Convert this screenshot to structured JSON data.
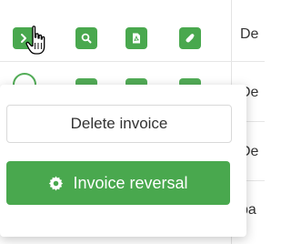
{
  "table": {
    "rows": [
      {
        "text": "De"
      },
      {
        "text": "De"
      },
      {
        "text": "De"
      },
      {
        "text": "pa"
      }
    ]
  },
  "toolbar": {
    "buttons": [
      {
        "name": "expand-button",
        "icon": "chevron-right-icon"
      },
      {
        "name": "view-button",
        "icon": "search-icon"
      },
      {
        "name": "pdf-button",
        "icon": "pdf-icon"
      },
      {
        "name": "attach-button",
        "icon": "paperclip-icon"
      }
    ]
  },
  "popup": {
    "delete_label": "Delete invoice",
    "reversal_label": "Invoice reversal",
    "reversal_icon": "gear-icon"
  },
  "colors": {
    "accent": "#49a84e",
    "border": "#d9d9d9"
  }
}
